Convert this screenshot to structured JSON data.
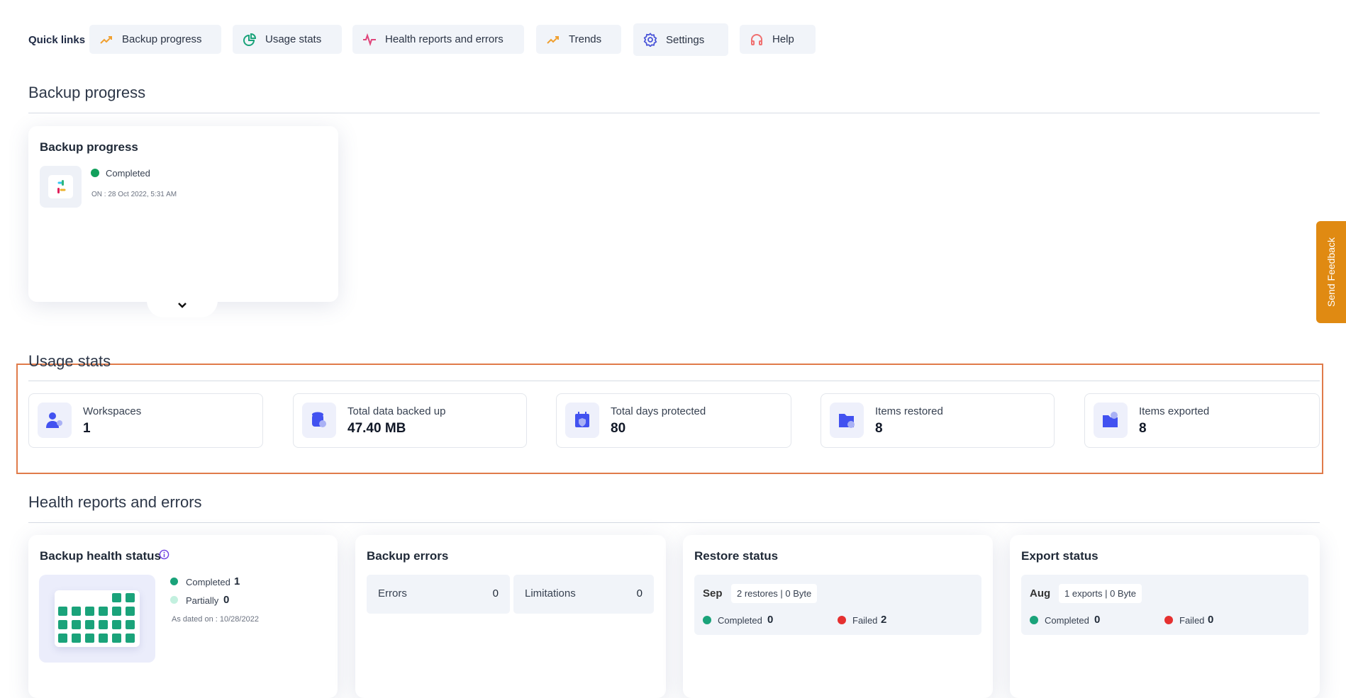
{
  "quick_links": {
    "label": "Quick links",
    "items": [
      {
        "label": "Backup progress",
        "icon": "trend-up-icon",
        "color": "#f0a030"
      },
      {
        "label": "Usage stats",
        "icon": "pie-chart-icon",
        "color": "#1aa37a"
      },
      {
        "label": "Health reports and errors",
        "icon": "pulse-icon",
        "color": "#e0457b"
      },
      {
        "label": "Trends",
        "icon": "trend-up-icon",
        "color": "#f0a030"
      },
      {
        "label": "Settings",
        "icon": "gear-icon",
        "color": "#4a55d8"
      },
      {
        "label": "Help",
        "icon": "headset-icon",
        "color": "#f07070"
      }
    ]
  },
  "backup_progress": {
    "heading": "Backup progress",
    "card_title": "Backup progress",
    "status": "Completed",
    "status_color": "#12a05c",
    "date": "ON : 28 Oct 2022, 5:31 AM"
  },
  "feedback": {
    "label": "Send Feedback",
    "color": "#e08a12"
  },
  "usage_stats": {
    "heading": "Usage stats",
    "accent": "#4252f0",
    "items": [
      {
        "label": "Workspaces",
        "value": "1",
        "icon": "user-gear-icon"
      },
      {
        "label": "Total data backed up",
        "value": "47.40 MB",
        "icon": "database-icon"
      },
      {
        "label": "Total days protected",
        "value": "80",
        "icon": "calendar-shield-icon"
      },
      {
        "label": "Items restored",
        "value": "8",
        "icon": "folder-restore-icon"
      },
      {
        "label": "Items exported",
        "value": "8",
        "icon": "folder-export-icon"
      }
    ]
  },
  "health": {
    "heading": "Health reports and errors",
    "health_status": {
      "title": "Backup health status",
      "completed_label": "Completed",
      "completed": "1",
      "partial_label": "Partially",
      "partial": "0",
      "dated": "As dated on : 10/28/2022"
    },
    "errors": {
      "title": "Backup errors",
      "errors_label": "Errors",
      "errors": "0",
      "limitations_label": "Limitations",
      "limitations": "0"
    },
    "restore": {
      "title": "Restore status",
      "month": "Sep",
      "summary": "2 restores | 0 Byte",
      "completed_label": "Completed",
      "completed": "0",
      "failed_label": "Failed",
      "failed": "2"
    },
    "export": {
      "title": "Export status",
      "month": "Aug",
      "summary": "1 exports | 0 Byte",
      "completed_label": "Completed",
      "completed": "0",
      "failed_label": "Failed",
      "failed": "0"
    }
  }
}
